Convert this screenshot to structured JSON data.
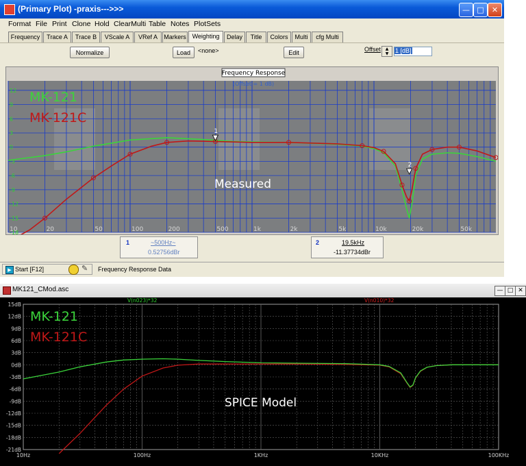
{
  "window1": {
    "title": "(Primary Plot) -praxis--->>>",
    "menu": [
      "Format",
      "File",
      "Print",
      "Clone",
      "Hold",
      "ClearMulti",
      "Table",
      "Notes",
      "PlotSets"
    ],
    "tabs": [
      "Frequency",
      "Trace A",
      "Trace B",
      "VScale A",
      "VRef A",
      "Markers",
      "Weighting",
      "Delay",
      "Title",
      "Colors",
      "Multi",
      "cfg Multi"
    ],
    "active_tab": "Weighting",
    "toolbar": {
      "normalize_label": "Normalize",
      "load_label": "Load",
      "none_text": "<none>",
      "edit_label": "Edit",
      "offset_label": "Offset",
      "offset_value": "1 [dB]"
    },
    "plot": {
      "title": "Frequency Response",
      "subtitle": "(Offset = 1 dB)",
      "overlay_text": "Measured",
      "legend": [
        {
          "name": "MK-121",
          "color": "#3bd43b"
        },
        {
          "name": "MK-121C",
          "color": "#c01818"
        }
      ],
      "y_ticks": [
        "12",
        "9",
        "6",
        "3",
        "0",
        "-3",
        "-6",
        "-9",
        "-12",
        "-15",
        "-18"
      ],
      "x_ticks": [
        "10",
        "20",
        "50",
        "100",
        "200",
        "500",
        "1k",
        "2k",
        "5k",
        "10k",
        "20k",
        "50k"
      ],
      "marker1_label": "1",
      "marker2_label": "2"
    },
    "cursor1": {
      "num": "1",
      "freq": "~500Hz~",
      "value": "0.52756dBr"
    },
    "cursor2": {
      "num": "2",
      "freq": "19.5kHz",
      "value": "-11.37734dBr"
    },
    "status": {
      "start_label": "Start [F12]",
      "text": "Frequency Response Data"
    }
  },
  "window2": {
    "title": "MK121_CMod.asc",
    "trace1_label": "V(n023)*32",
    "trace2_label": "V(n010)*32",
    "overlay_text": "SPICE Model",
    "legend": [
      {
        "name": "MK-121",
        "color": "#3bd43b"
      },
      {
        "name": "MK-121C",
        "color": "#c01818"
      }
    ],
    "y_ticks": [
      "15dB",
      "12dB",
      "9dB",
      "6dB",
      "3dB",
      "0dB",
      "-3dB",
      "-6dB",
      "-9dB",
      "-12dB",
      "-15dB",
      "-18dB",
      "-21dB"
    ],
    "x_ticks": [
      "10Hz",
      "100Hz",
      "1KHz",
      "10KHz",
      "100KHz"
    ]
  },
  "chart_data": [
    {
      "type": "line",
      "title": "Frequency Response",
      "subtitle": "(Offset = 1 dB)",
      "x_scale": "log",
      "xlim": [
        10,
        100000
      ],
      "ylim": [
        -18,
        14
      ],
      "series": [
        {
          "name": "MK-121",
          "color": "#3bd43b",
          "x": [
            10,
            20,
            30,
            50,
            100,
            200,
            400,
            700,
            1000,
            2000,
            5000,
            8000,
            10000,
            12000,
            15000,
            17000,
            18500,
            19500,
            20500,
            22000,
            25000,
            30000,
            40000,
            50000,
            70000,
            100000
          ],
          "y": [
            -2.8,
            -1.8,
            -1.0,
            0.2,
            1.5,
            2.0,
            1.6,
            1.2,
            1.1,
            1.0,
            0.6,
            0.2,
            -0.3,
            -1.2,
            -4,
            -9,
            -13,
            -15,
            -12,
            -6,
            -2.5,
            -1.5,
            -1.2,
            -1.3,
            -2,
            -3
          ]
        },
        {
          "name": "MK-121C",
          "color": "#c01818",
          "x": [
            10,
            15,
            20,
            30,
            50,
            70,
            100,
            150,
            200,
            300,
            500,
            1000,
            2000,
            5000,
            8000,
            10000,
            12000,
            15000,
            17000,
            18500,
            19500,
            20500,
            22000,
            25000,
            30000,
            40000,
            50000,
            70000,
            100000
          ],
          "y": [
            -20,
            -17.5,
            -15,
            -11,
            -6.5,
            -4,
            -1.5,
            0.2,
            1.0,
            1.3,
            1.2,
            1.0,
            1.0,
            0.7,
            0.3,
            -0.1,
            -0.9,
            -3.5,
            -8,
            -10.5,
            -11.4,
            -9,
            -4.5,
            -1.5,
            -0.5,
            0,
            0,
            -0.8,
            -2.2
          ]
        }
      ]
    },
    {
      "type": "line",
      "x_scale": "log",
      "xlim": [
        10,
        100000
      ],
      "ylim": [
        -21,
        15
      ],
      "series": [
        {
          "name": "MK-121",
          "color": "#3bd43b",
          "x": [
            10,
            20,
            30,
            50,
            70,
            100,
            150,
            200,
            300,
            500,
            1000,
            2000,
            5000,
            10000,
            12000,
            15000,
            17000,
            18000,
            19000,
            20000,
            22000,
            25000,
            30000,
            40000,
            50000,
            100000
          ],
          "y": [
            -3.5,
            -1.8,
            -0.5,
            0.7,
            1.2,
            1.4,
            1.5,
            1.4,
            1.1,
            0.8,
            0.5,
            0.4,
            0.3,
            0.0,
            -0.4,
            -2,
            -4.5,
            -5.5,
            -5,
            -3.2,
            -1.5,
            -0.6,
            -0.2,
            0,
            0,
            0
          ]
        },
        {
          "name": "MK-121C",
          "color": "#c01818",
          "x": [
            20,
            30,
            50,
            70,
            100,
            150,
            200,
            300,
            500,
            1000,
            2000,
            5000,
            10000,
            12000,
            15000,
            17000,
            18000,
            19000,
            20000,
            22000,
            25000,
            30000,
            40000,
            50000,
            100000
          ],
          "y": [
            -22,
            -17,
            -10,
            -6,
            -2.8,
            -0.8,
            -0.1,
            0.2,
            0.2,
            0.2,
            0.2,
            0.1,
            -0.1,
            -0.5,
            -2.2,
            -4.6,
            -5.6,
            -5.1,
            -3.3,
            -1.6,
            -0.6,
            -0.2,
            0,
            0,
            0
          ]
        }
      ]
    }
  ]
}
